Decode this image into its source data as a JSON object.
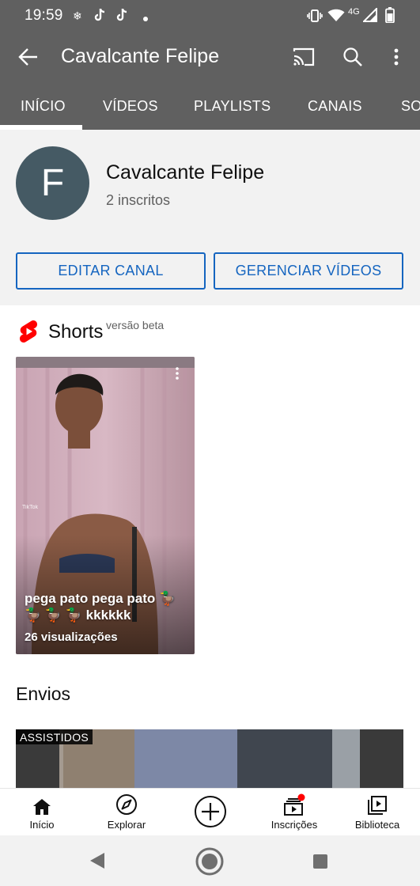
{
  "status_bar": {
    "time": "19:59",
    "network_label": "4G",
    "icons": [
      "fan-icon",
      "tiktok-icon",
      "tiktok-icon",
      "dot-icon",
      "vibrate-icon",
      "wifi-icon",
      "signal-icon",
      "battery-icon"
    ]
  },
  "app_bar": {
    "title": "Cavalcante Felipe",
    "icons": [
      "back-arrow-icon",
      "cast-icon",
      "search-icon",
      "more-vert-icon"
    ]
  },
  "tabs": [
    {
      "label": "INÍCIO",
      "selected": true
    },
    {
      "label": "VÍDEOS",
      "selected": false
    },
    {
      "label": "PLAYLISTS",
      "selected": false
    },
    {
      "label": "CANAIS",
      "selected": false
    },
    {
      "label": "SO",
      "selected": false
    }
  ],
  "channel": {
    "avatar_letter": "F",
    "avatar_color": "#455a64",
    "name": "Cavalcante Felipe",
    "subscribers": "2 inscritos",
    "edit_button": "EDITAR CANAL",
    "manage_button": "GERENCIAR VÍDEOS",
    "accent_color": "#1565c0"
  },
  "shorts": {
    "title": "Shorts",
    "beta_label": "versão beta",
    "items": [
      {
        "caption": "pega pato pega pato 🦆 🦆 🦆 🦆 kkkkkk",
        "views": "26 visualizações",
        "watermark": "TikTok"
      }
    ]
  },
  "uploads": {
    "title": "Envios",
    "items": [
      {
        "badge": "ASSISTIDOS"
      }
    ]
  },
  "bottom_nav": [
    {
      "label": "Início",
      "icon": "home-icon",
      "selected": true
    },
    {
      "label": "Explorar",
      "icon": "compass-icon",
      "selected": false
    },
    {
      "label": "",
      "icon": "create-plus-icon",
      "selected": false
    },
    {
      "label": "Inscrições",
      "icon": "subscriptions-icon",
      "selected": false,
      "notification": true
    },
    {
      "label": "Biblioteca",
      "icon": "library-icon",
      "selected": false
    }
  ],
  "system_nav": [
    "back-triangle-icon",
    "home-circle-icon",
    "recents-square-icon"
  ]
}
